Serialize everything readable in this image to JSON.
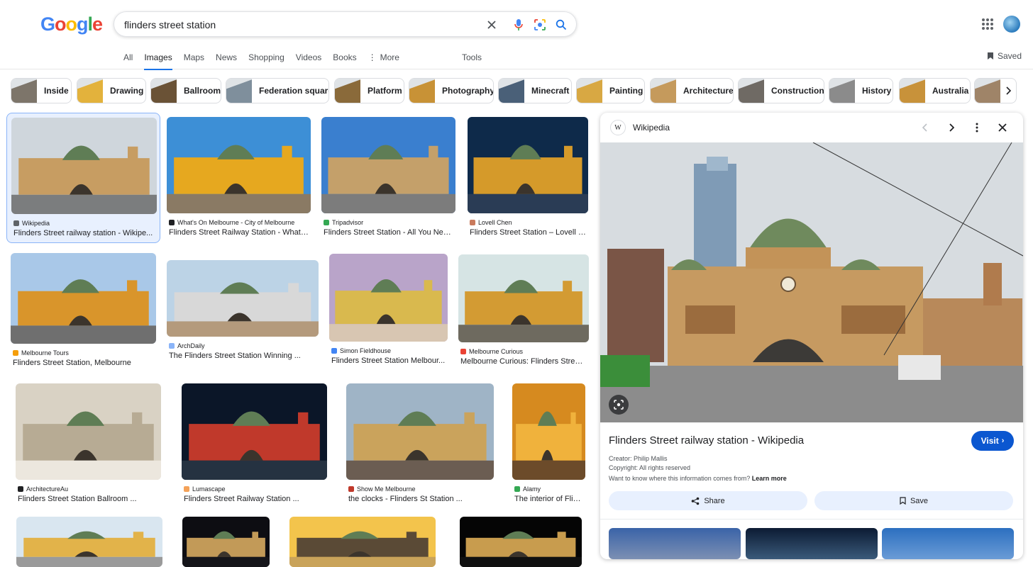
{
  "header": {
    "logo_letters": [
      "G",
      "o",
      "o",
      "g",
      "l",
      "e"
    ],
    "query": "flinders street station",
    "icons": [
      "close-icon",
      "microphone-icon",
      "lens-icon",
      "search-icon",
      "apps-grid-icon",
      "avatar"
    ]
  },
  "tabs": [
    {
      "label": "All",
      "active": false
    },
    {
      "label": "Images",
      "active": true
    },
    {
      "label": "Maps",
      "active": false
    },
    {
      "label": "News",
      "active": false
    },
    {
      "label": "Shopping",
      "active": false
    },
    {
      "label": "Videos",
      "active": false
    },
    {
      "label": "Books",
      "active": false
    },
    {
      "label": "More",
      "active": false
    }
  ],
  "tools_label": "Tools",
  "saved_label": "Saved",
  "chips": [
    {
      "label": "Inside",
      "color": "#7d756a"
    },
    {
      "label": "Drawing",
      "color": "#e3b23c"
    },
    {
      "label": "Ballroom",
      "color": "#6a5236"
    },
    {
      "label": "Federation square",
      "color": "#7f8f9c"
    },
    {
      "label": "Platform",
      "color": "#8a6a3a"
    },
    {
      "label": "Photography",
      "color": "#c89236"
    },
    {
      "label": "Minecraft",
      "color": "#4a6078"
    },
    {
      "label": "Painting",
      "color": "#d8a843"
    },
    {
      "label": "Architecture",
      "color": "#c59a5c"
    },
    {
      "label": "Construction",
      "color": "#6f6a64"
    },
    {
      "label": "History",
      "color": "#8b8b8b"
    },
    {
      "label": "Australia",
      "color": "#c8923a"
    },
    {
      "label": "",
      "color": "#9f8468"
    }
  ],
  "results": [
    {
      "source": "Wikipedia",
      "title": "Flinders Street railway station - Wikipe...",
      "fav": "#5f6368",
      "sky": "#cfd6dc",
      "bld": "#c79d62",
      "ground": "#7b7d7e"
    },
    {
      "source": "What's On Melbourne - City of Melbourne",
      "title": "Flinders Street Railway Station - What ...",
      "fav": "#202124",
      "sky": "#3d8fd6",
      "bld": "#e6a81f",
      "ground": "#8a7a64"
    },
    {
      "source": "Tripadvisor",
      "title": "Flinders Street Station - All You Nee...",
      "fav": "#34a853",
      "sky": "#3a7fcf",
      "bld": "#c4a06a",
      "ground": "#7c7c7c"
    },
    {
      "source": "Lovell Chen",
      "title": "Flinders Street Station – Lovell C...",
      "fav": "#c97a5c",
      "sky": "#0e2a4a",
      "bld": "#d59a2a",
      "ground": "#2a3c55"
    },
    {
      "source": "Melbourne Tours",
      "title": "Flinders Street Station, Melbourne",
      "fav": "#f59e0b",
      "sky": "#a9c8e8",
      "bld": "#d9952b",
      "ground": "#6f6f6f"
    },
    {
      "source": "ArchDaily",
      "title": "The Flinders Street Station Winning ...",
      "fav": "#8ab4f8",
      "sky": "#bcd3e6",
      "bld": "#d8d8d8",
      "ground": "#b49a7c"
    },
    {
      "source": "Simon Fieldhouse",
      "title": "Flinders Street Station Melbour...",
      "fav": "#4285f4",
      "sky": "#b9a4c9",
      "bld": "#d9b94e",
      "ground": "#d8c6b2"
    },
    {
      "source": "Melbourne Curious",
      "title": "Melbourne Curious: Flinders Street ...",
      "fav": "#ea4335",
      "sky": "#d6e4e4",
      "bld": "#d39b33",
      "ground": "#6e6a5f"
    },
    {
      "source": "ArchitectureAu",
      "title": "Flinders Street Station Ballroom ...",
      "fav": "#202124",
      "sky": "#d9d2c4",
      "bld": "#b7ab94",
      "ground": "#ece7de"
    },
    {
      "source": "Lumascape",
      "title": "Flinders Street Railway Station ...",
      "fav": "#f4a259",
      "sky": "#0b1628",
      "bld": "#c0392b",
      "ground": "#253241"
    },
    {
      "source": "Show Me Melbourne",
      "title": "the clocks - Flinders St Station ...",
      "fav": "#c0392b",
      "sky": "#9fb4c6",
      "bld": "#caa35c",
      "ground": "#6b5d52"
    },
    {
      "source": "Alamy",
      "title": "The interior of Flind...",
      "fav": "#34a853",
      "sky": "#d68a1f",
      "bld": "#f0b23c",
      "ground": "#6c4b2a"
    }
  ],
  "bottom_row": [
    {
      "sky": "#d9e6f0",
      "bld": "#e2b34a",
      "ground": "#9a9a9a"
    },
    {
      "sky": "#0d0d12",
      "bld": "#c29a58",
      "ground": "#15151a"
    },
    {
      "sky": "#f3c44c",
      "bld": "#5a4a36",
      "ground": "#c9a35a"
    },
    {
      "sky": "#050505",
      "bld": "#c89c4e",
      "ground": "#101010"
    }
  ],
  "panel": {
    "site": "Wikipedia",
    "favicon": "W",
    "title": "Flinders Street railway station - Wikipedia",
    "visit_label": "Visit",
    "creator": "Creator: Philip Mallis",
    "copyright": "Copyright: All rights reserved",
    "info": "Want to know where this information comes from?",
    "learn_more": "Learn more",
    "share_label": "Share",
    "save_label": "Save"
  }
}
